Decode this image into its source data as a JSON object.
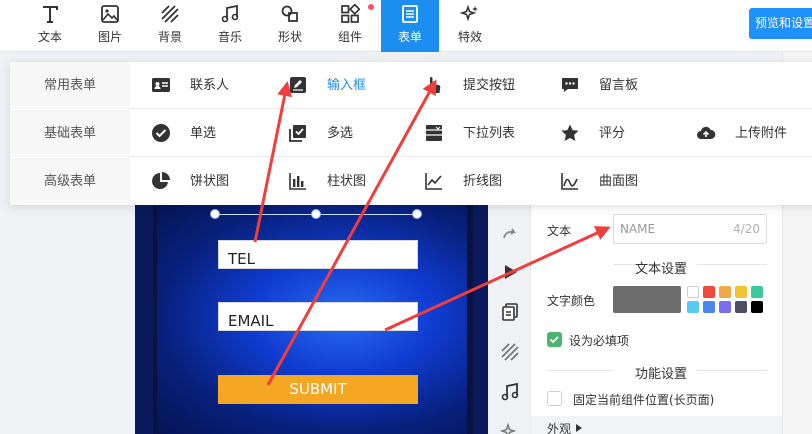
{
  "toolbar": {
    "tools": [
      {
        "label": "文本",
        "icon": "text-icon"
      },
      {
        "label": "图片",
        "icon": "image-icon"
      },
      {
        "label": "背景",
        "icon": "background-icon"
      },
      {
        "label": "音乐",
        "icon": "music-icon"
      },
      {
        "label": "形状",
        "icon": "shape-icon"
      },
      {
        "label": "组件",
        "icon": "component-icon"
      },
      {
        "label": "表单",
        "icon": "form-icon",
        "active": true
      },
      {
        "label": "特效",
        "icon": "effects-icon"
      }
    ],
    "preview_label": "预览和设置",
    "accent_color": "#1c8eef",
    "notify_dot_color": "#ff4d6a"
  },
  "dropdown": {
    "rows": [
      {
        "category": "常用表单",
        "items": [
          {
            "label": "联系人",
            "icon": "contact-card-icon"
          },
          {
            "label": "输入框",
            "icon": "edit-input-icon",
            "active": true
          },
          {
            "label": "提交按钮",
            "icon": "pointer-hand-icon"
          },
          {
            "label": "留言板",
            "icon": "message-board-icon"
          }
        ]
      },
      {
        "category": "基础表单",
        "items": [
          {
            "label": "单选",
            "icon": "radio-check-icon"
          },
          {
            "label": "多选",
            "icon": "checkbox-multi-icon"
          },
          {
            "label": "下拉列表",
            "icon": "dropdown-list-icon"
          },
          {
            "label": "评分",
            "icon": "star-icon"
          },
          {
            "label": "上传附件",
            "icon": "cloud-upload-icon"
          }
        ]
      },
      {
        "category": "高级表单",
        "items": [
          {
            "label": "饼状图",
            "icon": "pie-chart-icon"
          },
          {
            "label": "柱状图",
            "icon": "bar-chart-icon"
          },
          {
            "label": "折线图",
            "icon": "line-chart-icon"
          },
          {
            "label": "曲面图",
            "icon": "area-chart-icon"
          }
        ]
      }
    ]
  },
  "canvas": {
    "tel_text": "TEL",
    "email_text": "EMAIL",
    "submit_label": "SUBMIT",
    "submit_color": "#f5a623"
  },
  "panel": {
    "text_label": "文本",
    "text_placeholder": "NAME",
    "text_count": "4/20",
    "text_settings_title": "文本设置",
    "text_color_label": "文字颜色",
    "text_color": "#6d6d6d",
    "swatches": [
      "#ffffff",
      "#f04a3e",
      "#f0a84a",
      "#f5c233",
      "#3dc9a0",
      "#5ac8f5",
      "#4a86f0",
      "#7b6cf0",
      "#4a4f63",
      "#000000"
    ],
    "required_label": "设为必填项",
    "required_checked": true,
    "function_settings_title": "功能设置",
    "fix_position_label": "固定当前组件位置(长页面)",
    "fix_position_checked": false,
    "appearance_label": "外观"
  },
  "annotation_color": "#f23d3d"
}
